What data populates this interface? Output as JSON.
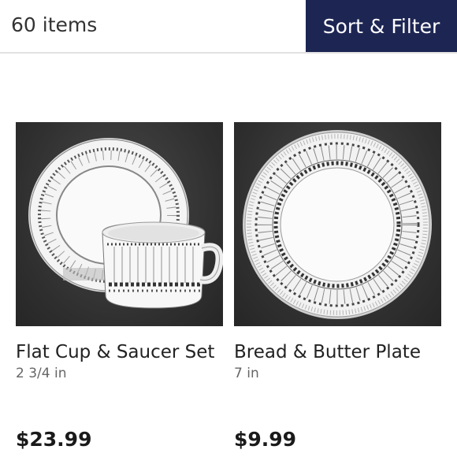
{
  "header": {
    "item_count": "60 items",
    "sort_filter_label": "Sort & Filter"
  },
  "products": [
    {
      "name": "Flat Cup & Saucer Set",
      "size": "2 3/4 in",
      "price": "$23.99",
      "image_icon": "cup-and-saucer"
    },
    {
      "name": "Bread & Butter Plate",
      "size": "7 in",
      "price": "$9.99",
      "image_icon": "plate"
    }
  ],
  "colors": {
    "button_bg": "#1d2653",
    "photo_bg": "#333333"
  }
}
